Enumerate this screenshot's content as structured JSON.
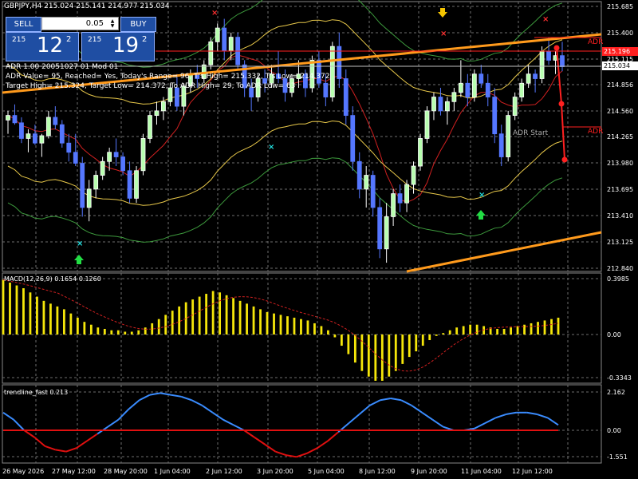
{
  "title": "GBPJPY,H4  215.024 215.141 214.977 215.034",
  "trade_panel": {
    "sell_label": "SELL",
    "buy_label": "BUY",
    "lot": "0.05",
    "sell_price_prefix": "215",
    "sell_price_main": "12",
    "sell_price_sup": "2",
    "buy_price_prefix": "215",
    "buy_price_main": "19",
    "buy_price_sup": "2"
  },
  "info_lines": [
    "ADR 1.00 20051027 01 Mod 01",
    "ADR Value= 95, Reached= Yes, Today's Range= 96,  T's High= 215.332, T's Low= 214.372",
    "Target High= 215.324, Target Low= 214.372, To ADR High= 29, To ADR Low= 63"
  ],
  "price_axis": [
    "215.685",
    "215.400",
    "215.115",
    "214.856",
    "214.560",
    "214.265",
    "213.980",
    "213.695",
    "213.410",
    "213.125",
    "212.840"
  ],
  "price_tags": {
    "red": "215.196",
    "current": "215.034"
  },
  "adr_labels": {
    "top": "ADR",
    "bottom": "ADR",
    "start": "ADR Start"
  },
  "macd": {
    "label": "MACD(12,26,9) 0.1654 0.1260",
    "axis": [
      "0.3985",
      "0.00",
      "-0.3343"
    ]
  },
  "trendline": {
    "label": "trendline_fast 0.213",
    "axis": [
      "2.162",
      "0.00",
      "-1.551"
    ]
  },
  "time_axis": [
    "26 May 2026",
    "27 May 12:00",
    "28 May 20:00",
    "1 Jun 04:00",
    "2 Jun 12:00",
    "3 Jun 20:00",
    "5 Jun 04:00",
    "8 Jun 12:00",
    "9 Jun 20:00",
    "11 Jun 04:00",
    "12 Jun 12:00"
  ],
  "colors": {
    "bull": "#ffffff",
    "bull_fill": "#b8ffb0",
    "bear": "#5577ff",
    "grid": "#6e6e6e",
    "orange": "#ff9a1c",
    "red": "#ff2020",
    "macd": "#f5e60a",
    "trend_up": "#3a8cff",
    "trend_down": "#e01010"
  },
  "chart_data": {
    "type": "candlestick",
    "symbol": "GBPJPY",
    "timeframe": "H4",
    "ylim": [
      212.84,
      215.685
    ],
    "candles": [
      [
        214.45,
        214.55,
        214.3,
        214.5
      ],
      [
        214.5,
        214.62,
        214.4,
        214.42
      ],
      [
        214.42,
        214.48,
        214.2,
        214.25
      ],
      [
        214.25,
        214.35,
        214.1,
        214.3
      ],
      [
        214.3,
        214.4,
        214.18,
        214.2
      ],
      [
        214.2,
        214.3,
        214.05,
        214.28
      ],
      [
        214.28,
        214.55,
        214.25,
        214.48
      ],
      [
        214.48,
        214.6,
        214.35,
        214.4
      ],
      [
        214.4,
        214.45,
        214.15,
        214.2
      ],
      [
        214.2,
        214.3,
        214.0,
        214.1
      ],
      [
        214.1,
        214.3,
        213.95,
        213.98
      ],
      [
        213.98,
        214.05,
        213.4,
        213.5
      ],
      [
        213.5,
        213.8,
        213.35,
        213.7
      ],
      [
        213.7,
        213.9,
        213.6,
        213.85
      ],
      [
        213.85,
        214.05,
        213.8,
        214.0
      ],
      [
        214.0,
        214.15,
        213.9,
        214.1
      ],
      [
        214.1,
        214.25,
        213.95,
        214.05
      ],
      [
        214.05,
        214.1,
        213.85,
        213.9
      ],
      [
        213.9,
        214.0,
        213.55,
        213.6
      ],
      [
        213.6,
        213.95,
        213.55,
        213.9
      ],
      [
        213.9,
        214.3,
        213.85,
        214.25
      ],
      [
        214.25,
        214.55,
        214.2,
        214.5
      ],
      [
        214.5,
        214.65,
        214.4,
        214.55
      ],
      [
        214.55,
        214.7,
        214.45,
        214.65
      ],
      [
        214.65,
        214.85,
        214.6,
        214.8
      ],
      [
        214.8,
        214.95,
        214.55,
        214.6
      ],
      [
        214.6,
        214.85,
        214.5,
        214.82
      ],
      [
        214.82,
        215.0,
        214.75,
        214.95
      ],
      [
        214.95,
        215.05,
        214.8,
        214.9
      ],
      [
        214.9,
        215.1,
        214.85,
        215.05
      ],
      [
        215.05,
        215.35,
        215.0,
        215.3
      ],
      [
        215.3,
        215.5,
        215.2,
        215.45
      ],
      [
        215.45,
        215.55,
        215.1,
        215.2
      ],
      [
        215.2,
        215.4,
        215.1,
        215.35
      ],
      [
        215.35,
        215.4,
        215.0,
        215.05
      ],
      [
        215.05,
        215.1,
        214.7,
        214.8
      ],
      [
        214.8,
        214.9,
        214.55,
        214.7
      ],
      [
        214.7,
        214.95,
        214.65,
        214.9
      ],
      [
        214.9,
        215.0,
        214.75,
        214.85
      ],
      [
        214.85,
        215.05,
        214.8,
        214.95
      ],
      [
        214.95,
        215.2,
        214.85,
        214.9
      ],
      [
        214.9,
        215.0,
        214.65,
        214.75
      ],
      [
        214.75,
        214.95,
        214.7,
        214.9
      ],
      [
        214.9,
        215.1,
        214.8,
        214.95
      ],
      [
        214.95,
        215.0,
        214.7,
        214.8
      ],
      [
        214.8,
        215.15,
        214.75,
        215.1
      ],
      [
        215.1,
        215.2,
        214.8,
        214.85
      ],
      [
        214.85,
        214.95,
        214.6,
        214.7
      ],
      [
        214.7,
        215.3,
        214.65,
        215.25
      ],
      [
        215.25,
        215.4,
        214.8,
        214.9
      ],
      [
        214.9,
        215.0,
        214.4,
        214.5
      ],
      [
        214.5,
        214.6,
        213.9,
        214.0
      ],
      [
        214.0,
        214.1,
        213.6,
        213.7
      ],
      [
        213.7,
        213.95,
        213.5,
        213.85
      ],
      [
        213.85,
        213.9,
        213.4,
        213.5
      ],
      [
        213.5,
        213.6,
        212.95,
        213.05
      ],
      [
        213.05,
        213.55,
        212.9,
        213.4
      ],
      [
        213.4,
        213.7,
        213.3,
        213.65
      ],
      [
        213.65,
        213.75,
        213.45,
        213.55
      ],
      [
        213.55,
        213.8,
        213.45,
        213.75
      ],
      [
        213.75,
        214.0,
        213.65,
        213.95
      ],
      [
        213.95,
        214.3,
        213.9,
        214.25
      ],
      [
        214.25,
        214.6,
        214.2,
        214.55
      ],
      [
        214.55,
        214.75,
        214.45,
        214.7
      ],
      [
        214.7,
        214.8,
        214.5,
        214.55
      ],
      [
        214.55,
        214.7,
        214.4,
        214.65
      ],
      [
        214.65,
        214.8,
        214.55,
        214.75
      ],
      [
        214.75,
        215.1,
        214.7,
        214.85
      ],
      [
        214.85,
        214.95,
        214.6,
        214.7
      ],
      [
        214.7,
        215.0,
        214.65,
        214.95
      ],
      [
        214.95,
        215.05,
        214.8,
        214.85
      ],
      [
        214.85,
        214.95,
        214.6,
        214.7
      ],
      [
        214.7,
        214.8,
        214.2,
        214.3
      ],
      [
        214.3,
        214.4,
        213.95,
        214.05
      ],
      [
        214.05,
        214.55,
        214.0,
        214.5
      ],
      [
        214.5,
        214.75,
        214.45,
        214.7
      ],
      [
        214.7,
        214.9,
        214.65,
        214.85
      ],
      [
        214.85,
        215.05,
        214.8,
        214.95
      ],
      [
        214.95,
        215.0,
        214.75,
        214.9
      ],
      [
        214.9,
        215.25,
        214.85,
        215.2
      ],
      [
        215.2,
        215.35,
        215.05,
        215.1
      ],
      [
        215.1,
        215.2,
        214.95,
        215.15
      ],
      [
        215.15,
        215.3,
        214.98,
        215.03
      ]
    ],
    "macd_hist": [
      0.39,
      0.37,
      0.35,
      0.33,
      0.3,
      0.27,
      0.24,
      0.22,
      0.2,
      0.18,
      0.15,
      0.12,
      0.09,
      0.07,
      0.05,
      0.04,
      0.03,
      0.03,
      0.02,
      0.02,
      0.03,
      0.05,
      0.08,
      0.11,
      0.14,
      0.17,
      0.2,
      0.23,
      0.25,
      0.27,
      0.29,
      0.31,
      0.3,
      0.28,
      0.26,
      0.24,
      0.22,
      0.2,
      0.18,
      0.16,
      0.15,
      0.14,
      0.13,
      0.12,
      0.11,
      0.1,
      0.08,
      0.06,
      0.03,
      -0.02,
      -0.08,
      -0.14,
      -0.2,
      -0.26,
      -0.3,
      -0.33,
      -0.33,
      -0.3,
      -0.26,
      -0.21,
      -0.16,
      -0.12,
      -0.08,
      -0.04,
      -0.01,
      0.01,
      0.03,
      0.05,
      0.06,
      0.07,
      0.07,
      0.06,
      0.05,
      0.04,
      0.04,
      0.05,
      0.06,
      0.07,
      0.08,
      0.09,
      0.1,
      0.11,
      0.12
    ],
    "trendline_fast": [
      1.0,
      0.6,
      0.0,
      -0.4,
      -0.9,
      -1.1,
      -1.2,
      -1.0,
      -0.6,
      -0.2,
      0.2,
      0.6,
      1.2,
      1.7,
      2.0,
      2.1,
      2.0,
      1.9,
      1.7,
      1.4,
      1.0,
      0.6,
      0.3,
      0.0,
      -0.4,
      -0.8,
      -1.2,
      -1.4,
      -1.5,
      -1.3,
      -1.0,
      -0.6,
      -0.1,
      0.4,
      0.9,
      1.4,
      1.7,
      1.8,
      1.7,
      1.4,
      1.0,
      0.6,
      0.2,
      0.0,
      0.0,
      0.1,
      0.4,
      0.7,
      0.9,
      1.0,
      1.0,
      0.9,
      0.7,
      0.3
    ]
  }
}
